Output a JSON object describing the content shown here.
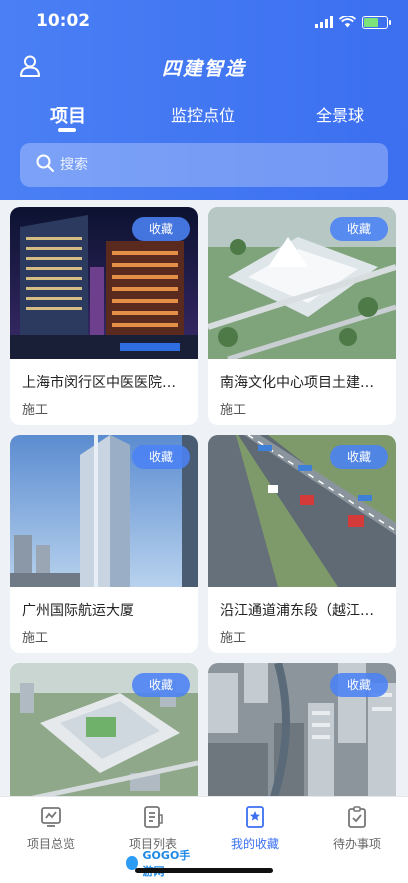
{
  "status_bar": {
    "time": "10:02"
  },
  "header": {
    "title": "四建智造"
  },
  "tabs": [
    {
      "label": "项目",
      "active": true
    },
    {
      "label": "监控点位",
      "active": false
    },
    {
      "label": "全景球",
      "active": false
    }
  ],
  "search": {
    "placeholder": "搜索"
  },
  "projects": [
    {
      "title": "上海市闵行区中医医院…",
      "status": "施工",
      "badge": "收藏"
    },
    {
      "title": "南海文化中心项目土建…",
      "status": "施工",
      "badge": "收藏"
    },
    {
      "title": "广州国际航运大厦",
      "status": "施工",
      "badge": "收藏"
    },
    {
      "title": "沿江通道浦东段（越江…",
      "status": "施工",
      "badge": "收藏"
    },
    {
      "title": "",
      "status": "",
      "badge": "收藏"
    },
    {
      "title": "",
      "status": "",
      "badge": "收藏"
    }
  ],
  "tabbar": [
    {
      "label": "项目总览",
      "icon": "chart-icon",
      "active": false
    },
    {
      "label": "项目列表",
      "icon": "list-doc-icon",
      "active": false
    },
    {
      "label": "我的收藏",
      "icon": "bookmark-star-icon",
      "active": true
    },
    {
      "label": "待办事项",
      "icon": "clipboard-check-icon",
      "active": false
    }
  ],
  "watermark": {
    "text": "GOGO手游网"
  },
  "colors": {
    "primary": "#3b6ff0",
    "badge": "#4b82f5"
  }
}
